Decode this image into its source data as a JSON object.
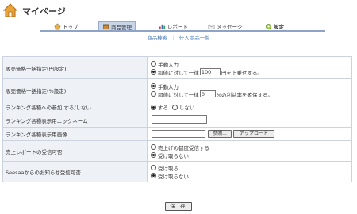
{
  "header": {
    "title": "マイページ"
  },
  "tabs": [
    {
      "label": "トップ",
      "icon": "home-icon"
    },
    {
      "label": "商品管理",
      "icon": "box-icon",
      "active": true
    },
    {
      "label": "レポート",
      "icon": "chart-icon"
    },
    {
      "label": "メッセージ",
      "icon": "message-icon"
    },
    {
      "label": "設定",
      "icon": "gear-icon"
    }
  ],
  "sublinks": {
    "item1": "商品検索",
    "separator": "｜",
    "item2": "仕入商品一覧"
  },
  "rows": {
    "price_yen": {
      "label": "販売価格一括指定(円設定)",
      "opt_manual": "手動入力",
      "opt_prefix": "卸値に対して一律",
      "value": "100",
      "opt_suffix": "円を上乗せする。"
    },
    "price_pct": {
      "label": "販売価格一括指定(%設定)",
      "opt_manual": "手動入力",
      "opt_prefix": "卸値に対して一律",
      "value": "0",
      "opt_suffix": "%の利益率を確保する。"
    },
    "ranking": {
      "label": "ランキング各種への参加 する/しない",
      "opt_yes": "する",
      "opt_no": "しない"
    },
    "nickname": {
      "label": "ランキング各種表示用ニックネーム",
      "value": ""
    },
    "image": {
      "label": "ランキング各種表示用画像",
      "value": "",
      "browse": "参照...",
      "upload": "アップロード"
    },
    "sales_report": {
      "label": "売上レポートの受信可否",
      "opt_each": "売上げの都度受信する",
      "opt_no": "受け取らない"
    },
    "seesaa": {
      "label": "Seesaaからのお知らせ受信可否",
      "opt_yes": "受け取る",
      "opt_no": "受け取らない"
    }
  },
  "save_label": "保 存"
}
